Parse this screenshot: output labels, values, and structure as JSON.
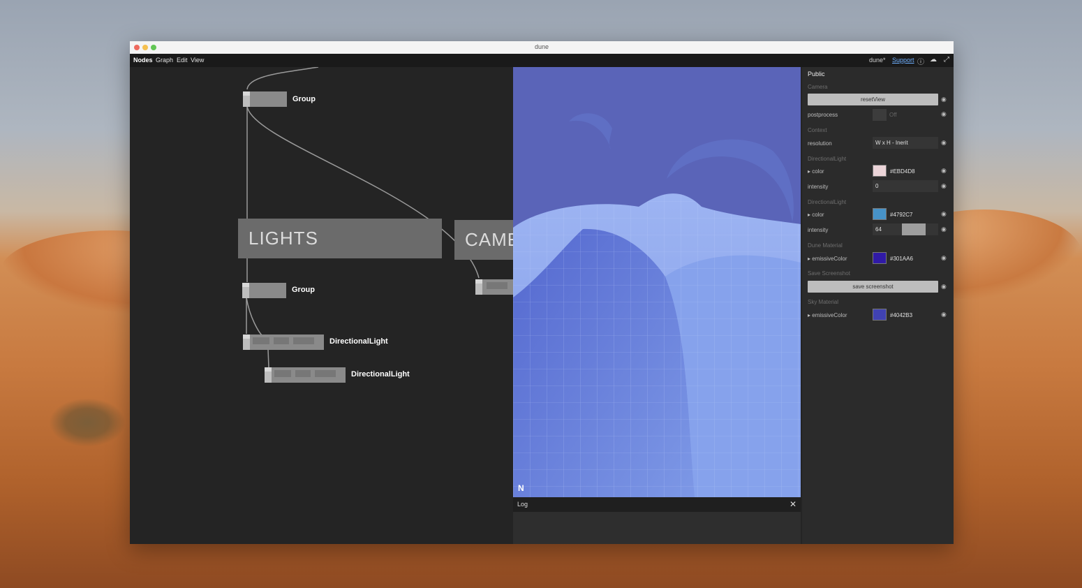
{
  "window": {
    "title": "dune"
  },
  "menubar": {
    "items": [
      "Nodes",
      "Graph",
      "Edit",
      "View"
    ],
    "project": "dune*",
    "support_label": "Support"
  },
  "graph": {
    "nodes": [
      {
        "label": "Group"
      },
      {
        "label": "Group"
      },
      {
        "label": "DirectionalLight"
      },
      {
        "label": "DirectionalLight"
      }
    ],
    "sections": [
      "LIGHTS",
      "CAMERA"
    ]
  },
  "viewport": {
    "logo": "N",
    "colors": {
      "sky": "#5a64b8",
      "dune_light": "#8ea8ee",
      "dune_dark": "#4a5cc4"
    }
  },
  "log": {
    "title": "Log",
    "close": "✕"
  },
  "panel": {
    "title": "Public",
    "camera": {
      "section": "Camera",
      "reset_label": "resetView",
      "postprocess_label": "postprocess",
      "postprocess_value": "Off"
    },
    "context": {
      "section": "Context",
      "resolution_label": "resolution",
      "resolution_value": "W x H - Inerit"
    },
    "light1": {
      "section": "DirectionalLight",
      "color_label": "color",
      "color_value": "#EBD4D8",
      "intensity_label": "intensity",
      "intensity_value": "0"
    },
    "light2": {
      "section": "DirectionalLight",
      "color_label": "color",
      "color_value": "#4792C7",
      "intensity_label": "intensity",
      "intensity_value": "64",
      "intensity_level": 0.64
    },
    "dune_material": {
      "section": "Dune Material",
      "emissive_label": "emissiveColor",
      "emissive_value": "#301AA6"
    },
    "screenshot": {
      "section": "Save Screenshot",
      "button_label": "save screenshot"
    },
    "sky_material": {
      "section": "Sky Material",
      "emissive_label": "emissiveColor",
      "emissive_value": "#4042B3"
    }
  }
}
